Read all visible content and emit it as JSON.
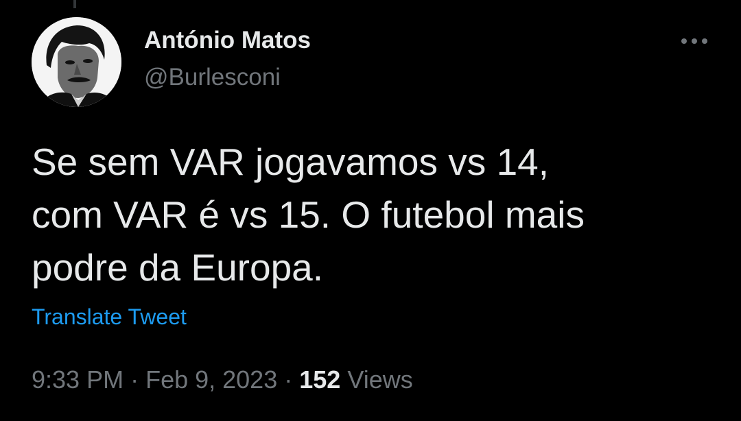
{
  "tweet": {
    "author": {
      "display_name": "António Matos",
      "handle": "@Burlesconi"
    },
    "text": "Se sem VAR jogavamos vs 14,\ncom VAR é vs 15. O futebol mais\npodre da Europa.",
    "translate_label": "Translate Tweet",
    "time": "9:33 PM",
    "separator": " · ",
    "date": "Feb 9, 2023",
    "views_count": "152",
    "views_label": "Views",
    "more_icon": "more-horizontal-icon"
  },
  "colors": {
    "background": "#000000",
    "primary_text": "#e7e9ea",
    "secondary_text": "#71767b",
    "link": "#1d9bf0"
  }
}
